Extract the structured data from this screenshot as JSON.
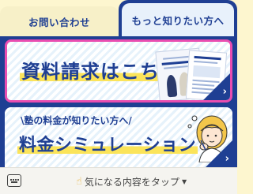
{
  "tabs": {
    "contact_label": "お問い合わせ",
    "more_info_label": "もっと知りたい方へ",
    "active": "more_info"
  },
  "cards": {
    "brochure": {
      "title": "資料請求はこちら",
      "arrow_icon": "chevron-right-icon",
      "illustration": "brochure-icon"
    },
    "simulation": {
      "subtitle": "\\塾の料金が知りたい方へ/",
      "title": "料金シミュレーション",
      "arrow_icon": "chevron-right-icon",
      "illustration": "thinking-girl-icon"
    }
  },
  "bottom_bar": {
    "keyboard_icon": "keyboard-icon",
    "hand_icon": "pointing-hand-icon",
    "tap_label": "気になる内容をタップ",
    "caret_icon": "caret-down-icon"
  },
  "colors": {
    "navy": "#1f3f93",
    "highlight_yellow": "#fbe45a",
    "card_border_pink": "#e94db0",
    "page_bg": "#fdf6cf"
  }
}
